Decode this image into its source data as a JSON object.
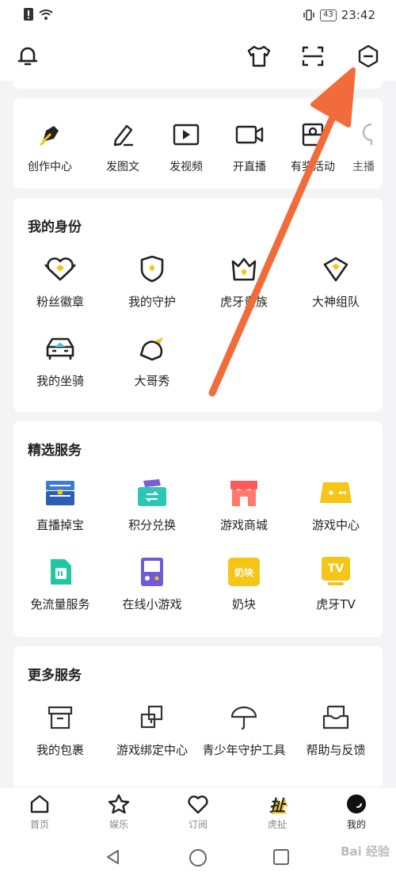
{
  "status_bar": {
    "time": "23:42",
    "battery": "43"
  },
  "top_icons": [
    "bell-icon",
    "shirt-icon",
    "scan-icon",
    "settings-hexagon-icon"
  ],
  "creator_tools": [
    {
      "label": "创作中心",
      "icon": "pen-icon"
    },
    {
      "label": "发图文",
      "icon": "edit-icon"
    },
    {
      "label": "发视频",
      "icon": "video-play-icon"
    },
    {
      "label": "开直播",
      "icon": "camera-icon"
    },
    {
      "label": "有奖活动",
      "icon": "gift-icon"
    },
    {
      "label": "主播",
      "icon": "anchor-icon"
    }
  ],
  "identity": {
    "title": "我的身份",
    "items": [
      {
        "label": "粉丝徽章",
        "icon": "fan-badge-icon"
      },
      {
        "label": "我的守护",
        "icon": "guard-icon"
      },
      {
        "label": "虎牙贵族",
        "icon": "crown-icon"
      },
      {
        "label": "大神组队",
        "icon": "team-icon"
      },
      {
        "label": "我的坐骑",
        "icon": "car-icon"
      },
      {
        "label": "大哥秀",
        "icon": "show-icon"
      }
    ]
  },
  "services": {
    "title": "精选服务",
    "items": [
      {
        "label": "直播掉宝",
        "icon": "treasure-chest-icon"
      },
      {
        "label": "积分兑换",
        "icon": "points-exchange-icon"
      },
      {
        "label": "游戏商城",
        "icon": "shop-icon"
      },
      {
        "label": "游戏中心",
        "icon": "gamepad-icon"
      },
      {
        "label": "免流量服务",
        "icon": "sim-card-icon"
      },
      {
        "label": "在线小游戏",
        "icon": "handheld-game-icon"
      },
      {
        "label": "奶块",
        "icon": "naikuai-icon",
        "icon_text": "奶块"
      },
      {
        "label": "虎牙TV",
        "icon": "tv-icon",
        "icon_text": "TV"
      }
    ]
  },
  "more": {
    "title": "更多服务",
    "items": [
      {
        "label": "我的包裹",
        "icon": "package-icon"
      },
      {
        "label": "游戏绑定中心",
        "icon": "bind-icon"
      },
      {
        "label": "青少年守护工具",
        "icon": "umbrella-icon"
      },
      {
        "label": "帮助与反馈",
        "icon": "inbox-icon"
      }
    ]
  },
  "tabs": [
    {
      "label": "首页",
      "icon": "home-icon"
    },
    {
      "label": "娱乐",
      "icon": "star-icon"
    },
    {
      "label": "订阅",
      "icon": "heart-icon"
    },
    {
      "label": "虎扯",
      "icon": "huche-icon",
      "icon_text": "扯"
    },
    {
      "label": "我的",
      "icon": "profile-icon",
      "active": true
    }
  ],
  "watermark": "Bai 经验",
  "colors": {
    "accent": "#f5c518",
    "arrow": "#f26b3a"
  }
}
